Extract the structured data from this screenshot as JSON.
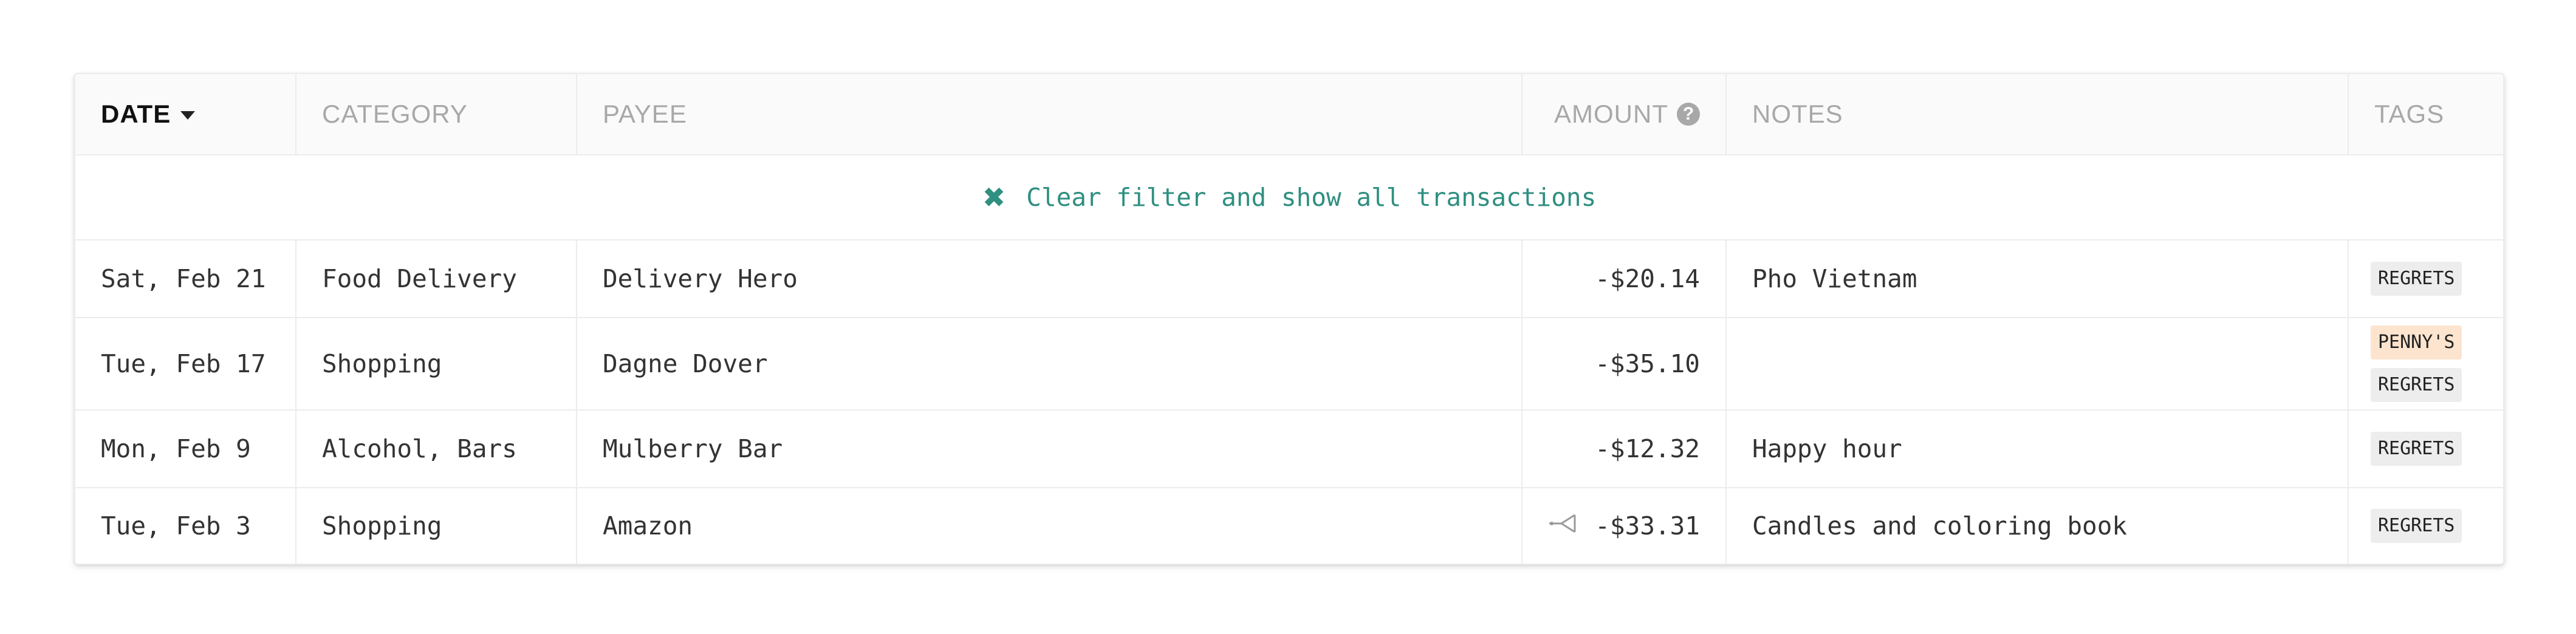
{
  "table": {
    "headers": {
      "date": "DATE",
      "category": "CATEGORY",
      "payee": "PAYEE",
      "amount": "AMOUNT",
      "notes": "NOTES",
      "tags": "TAGS"
    },
    "help_icon_glyph": "?",
    "filter_banner": {
      "icon": "close-icon",
      "label": "Clear filter and show all transactions"
    },
    "rows": [
      {
        "date": "Sat, Feb 21",
        "category": "Food Delivery",
        "payee": "Delivery Hero",
        "amount": "-$20.14",
        "notes": "Pho Vietnam",
        "tags": [
          "REGRETS"
        ],
        "split": false
      },
      {
        "date": "Tue, Feb 17",
        "category": "Shopping",
        "payee": "Dagne Dover",
        "amount": "-$35.10",
        "notes": "",
        "tags": [
          "PENNY'S",
          "REGRETS"
        ],
        "split": false
      },
      {
        "date": "Mon, Feb 9",
        "category": "Alcohol, Bars",
        "payee": "Mulberry Bar",
        "amount": "-$12.32",
        "notes": "Happy hour",
        "tags": [
          "REGRETS"
        ],
        "split": false
      },
      {
        "date": "Tue, Feb 3",
        "category": "Shopping",
        "payee": "Amazon",
        "amount": "-$33.31",
        "notes": "Candles and coloring book",
        "tags": [
          "REGRETS"
        ],
        "split": true
      }
    ]
  },
  "colors": {
    "accent": "#2f8f80",
    "tag_default": "#ededed",
    "tag_highlight": "#fde4cf"
  }
}
